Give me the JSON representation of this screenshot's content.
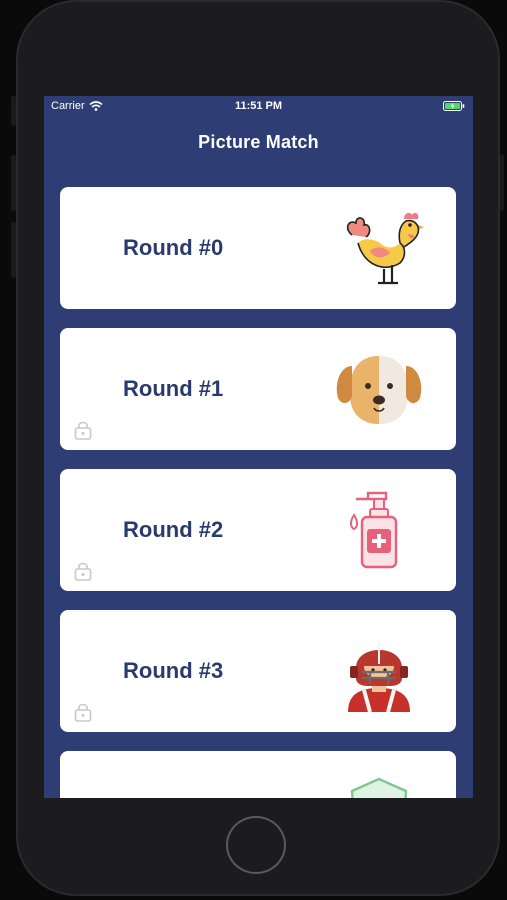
{
  "status_bar": {
    "carrier": "Carrier",
    "time": "11:51 PM"
  },
  "nav": {
    "title": "Picture Match"
  },
  "rounds": [
    {
      "label": "Round #0",
      "icon": "rooster-icon",
      "locked": false
    },
    {
      "label": "Round #1",
      "icon": "dog-face-icon",
      "locked": true
    },
    {
      "label": "Round #2",
      "icon": "hand-sanitizer-icon",
      "locked": true
    },
    {
      "label": "Round #3",
      "icon": "football-player-icon",
      "locked": true
    },
    {
      "label": "",
      "icon": "shield-icon",
      "locked": false
    }
  ],
  "colors": {
    "background": "#2e3e75",
    "card": "#ffffff",
    "label": "#2b3a6e",
    "lock": "#c8c8c8"
  }
}
